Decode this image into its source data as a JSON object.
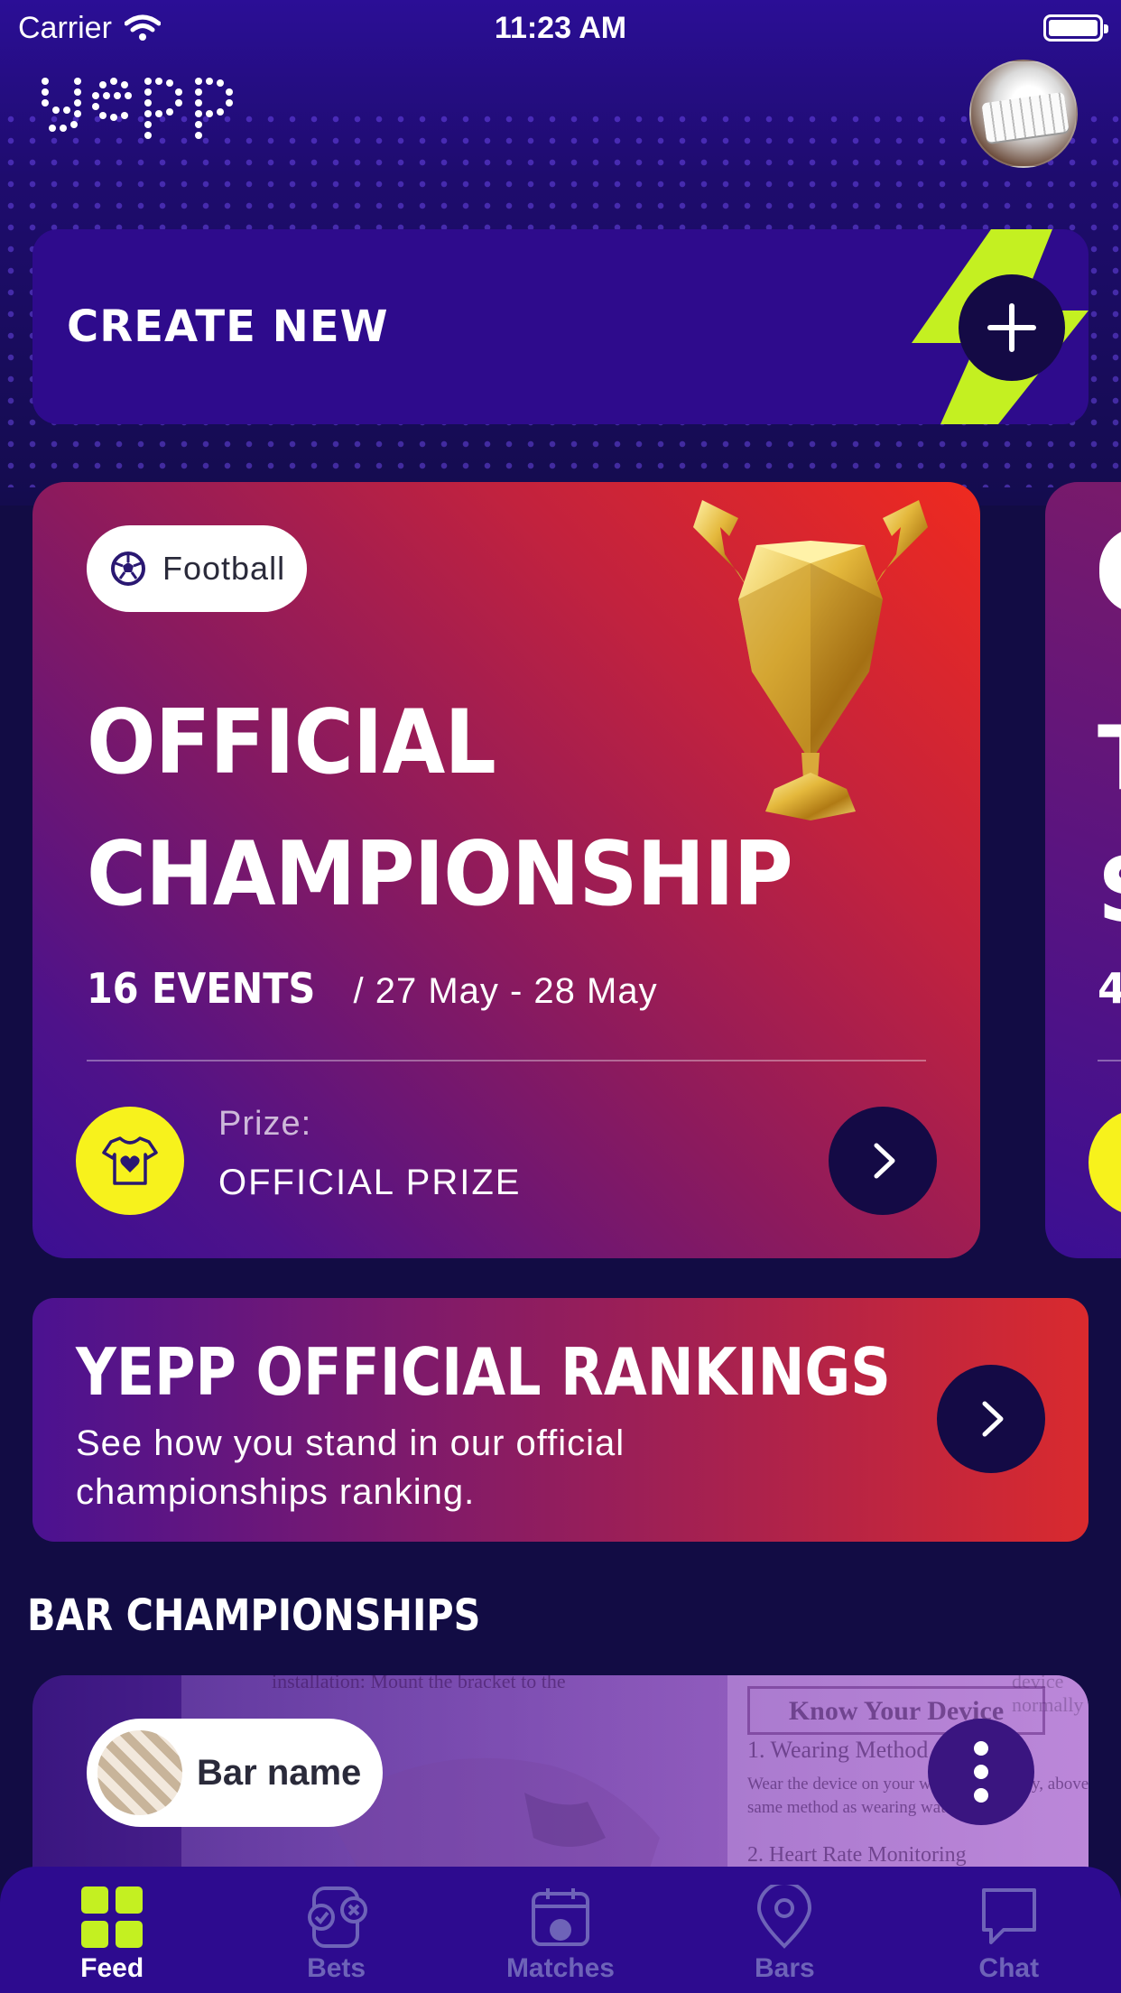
{
  "status_bar": {
    "carrier": "Carrier",
    "time": "11:23 AM"
  },
  "header": {
    "logo_text": "yepp"
  },
  "create": {
    "label": "CREATE NEW"
  },
  "championship": {
    "sport": "Football",
    "title_line1": "OFFICIAL",
    "title_line2": "CHAMPIONSHIP",
    "events": "16 EVENTS",
    "dates": "/ 27 May - 28 May",
    "prize_label": "Prize:",
    "prize_value": "OFFICIAL PRIZE"
  },
  "championship_peek": {
    "title_letter_1": "T",
    "title_letter_2": "S",
    "events_digit": "4"
  },
  "rankings": {
    "title": "YEPP OFFICIAL RANKINGS",
    "description": "See how you stand in our official championships ranking."
  },
  "bar_section": {
    "title": "BAR CHAMPIONSHIPS",
    "bar_name": "Bar name",
    "photo_text": {
      "heading": "Know Your Device",
      "item1": "1. Wearing Method",
      "body": "Wear the device on your wrist horizontally, above same method as wearing watches",
      "item2": "2. Heart Rate Monitoring",
      "top": "installation: Mount the bracket to the",
      "top_right": "device normally"
    }
  },
  "tabs": [
    {
      "label": "Feed",
      "icon": "grid-icon"
    },
    {
      "label": "Bets",
      "icon": "bets-icon"
    },
    {
      "label": "Matches",
      "icon": "calendar-icon"
    },
    {
      "label": "Bars",
      "icon": "location-pin-icon"
    },
    {
      "label": "Chat",
      "icon": "chat-bubble-icon"
    }
  ],
  "colors": {
    "accent": "#c4f021",
    "background": "#120c44",
    "card_purple": "#2e0b8c",
    "prize_yellow": "#f7f21c",
    "inactive_tab": "#6e63b8"
  }
}
